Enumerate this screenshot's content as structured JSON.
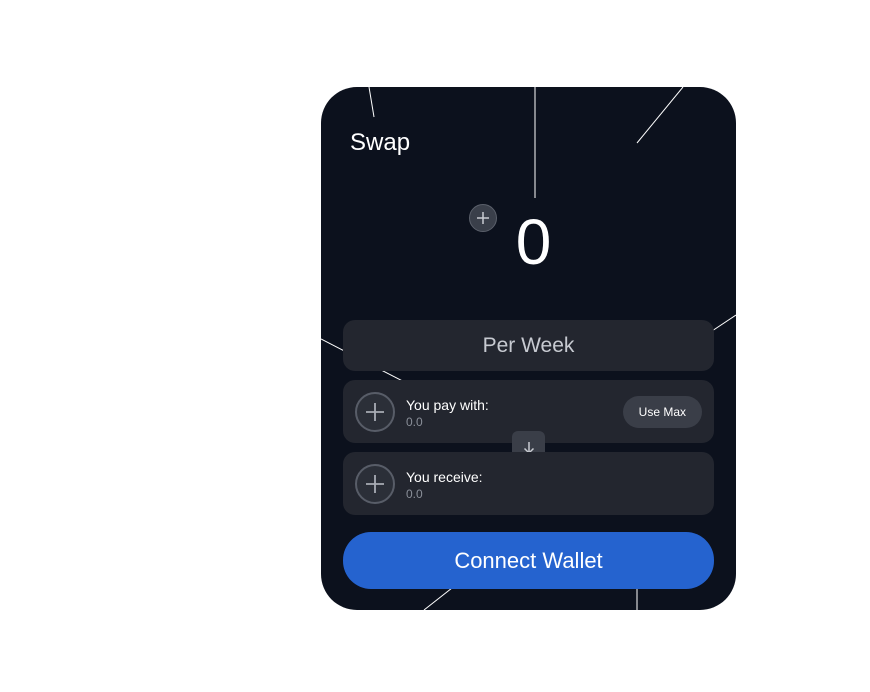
{
  "header": {
    "title": "Swap"
  },
  "amount": {
    "value": "0"
  },
  "frequency": {
    "label": "Per Week"
  },
  "pay": {
    "label": "You pay with:",
    "value": "0.0",
    "max_label": "Use Max"
  },
  "receive": {
    "label": "You receive:",
    "value": "0.0"
  },
  "actions": {
    "connect_label": "Connect Wallet"
  },
  "colors": {
    "card_bg": "#0c111d",
    "panel_bg": "#23262f",
    "accent": "#2563cf"
  },
  "icons": {
    "amount_add": "plus-icon",
    "token_select": "plus-icon",
    "switch": "arrow-down-icon"
  }
}
